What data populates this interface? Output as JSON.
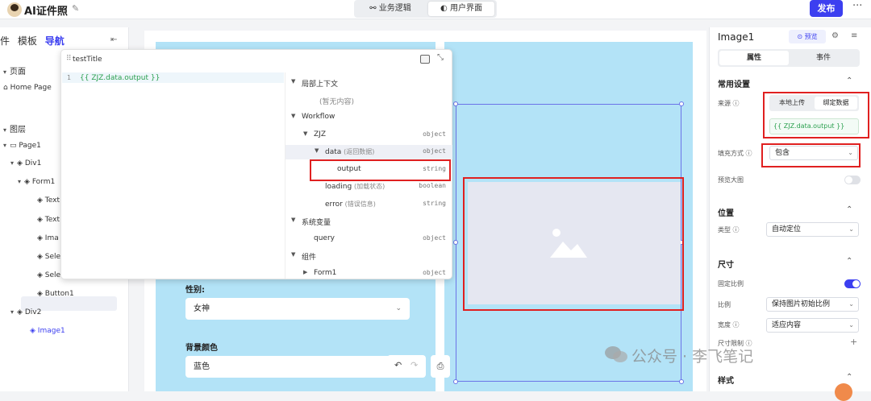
{
  "app": {
    "title": "AI证件照",
    "mode_tabs": [
      "业务逻辑",
      "用户界面"
    ],
    "active_mode": "用户界面",
    "publish_label": "发布"
  },
  "left_panel": {
    "tabs": [
      "件",
      "模板",
      "导航"
    ],
    "active_tab": "导航",
    "pages_heading": "页面",
    "pages": [
      "Home Page"
    ],
    "layers_heading": "图层",
    "layers": [
      {
        "label": "Page1"
      },
      {
        "label": "Div1"
      },
      {
        "label": "Form1"
      },
      {
        "label": "Text"
      },
      {
        "label": "Text"
      },
      {
        "label": "Ima"
      },
      {
        "label": "Sele"
      },
      {
        "label": "Sele"
      },
      {
        "label": "Button1"
      },
      {
        "label": "Div2"
      },
      {
        "label": "Image1"
      }
    ]
  },
  "canvas": {
    "gender_label": "性别:",
    "gender_value": "女神",
    "bg_color_label": "背景颜色",
    "bg_color_value": "蓝色"
  },
  "modal": {
    "title": "testTitle",
    "line_number": "1",
    "code": "{{ ZJZ.data.output }}",
    "context": [
      {
        "name": "局部上下文",
        "sub": "",
        "type": "",
        "caret": "▼"
      },
      {
        "name": "(暂无内容)",
        "sub": "",
        "type": "",
        "caret": ""
      },
      {
        "name": "Workflow",
        "sub": "",
        "type": "",
        "caret": "▼"
      },
      {
        "name": "ZJZ",
        "sub": "",
        "type": "object",
        "caret": "▼"
      },
      {
        "name": "data",
        "sub": "(返回数据)",
        "type": "object",
        "caret": "▼"
      },
      {
        "name": "output",
        "sub": "",
        "type": "string",
        "caret": ""
      },
      {
        "name": "loading",
        "sub": "(加载状态)",
        "type": "boolean",
        "caret": ""
      },
      {
        "name": "error",
        "sub": "(错误信息)",
        "type": "string",
        "caret": ""
      },
      {
        "name": "系统变量",
        "sub": "",
        "type": "",
        "caret": "▼"
      },
      {
        "name": "query",
        "sub": "",
        "type": "object",
        "caret": ""
      },
      {
        "name": "组件",
        "sub": "",
        "type": "",
        "caret": "▼"
      },
      {
        "name": "Form1",
        "sub": "",
        "type": "object",
        "caret": "▶"
      }
    ]
  },
  "right_panel": {
    "component_name": "Image1",
    "preview_label": "预览",
    "tabs": [
      "属性",
      "事件"
    ],
    "active_tab": "属性",
    "common_heading": "常用设置",
    "source_label": "来源",
    "source_options": [
      "本地上传",
      "绑定数据"
    ],
    "source_selected": "绑定数据",
    "source_value": "{{ ZJZ.data.output }}",
    "fill_label": "填充方式",
    "fill_value": "包含",
    "preview_big_label": "预览大图",
    "position_heading": "位置",
    "type_label": "类型",
    "type_value": "自动定位",
    "size_heading": "尺寸",
    "fixed_ratio_label": "固定比例",
    "ratio_label": "比例",
    "ratio_value": "保持图片初始比例",
    "width_label": "宽度",
    "width_value": "适应内容",
    "size_limit_label": "尺寸限制",
    "style_heading": "样式"
  },
  "watermark": "公众号 · 李飞笔记",
  "colors": {
    "accent": "#3c3ff0",
    "canvas_blue": "#b3e3f7",
    "highlight_red": "#e02020"
  }
}
